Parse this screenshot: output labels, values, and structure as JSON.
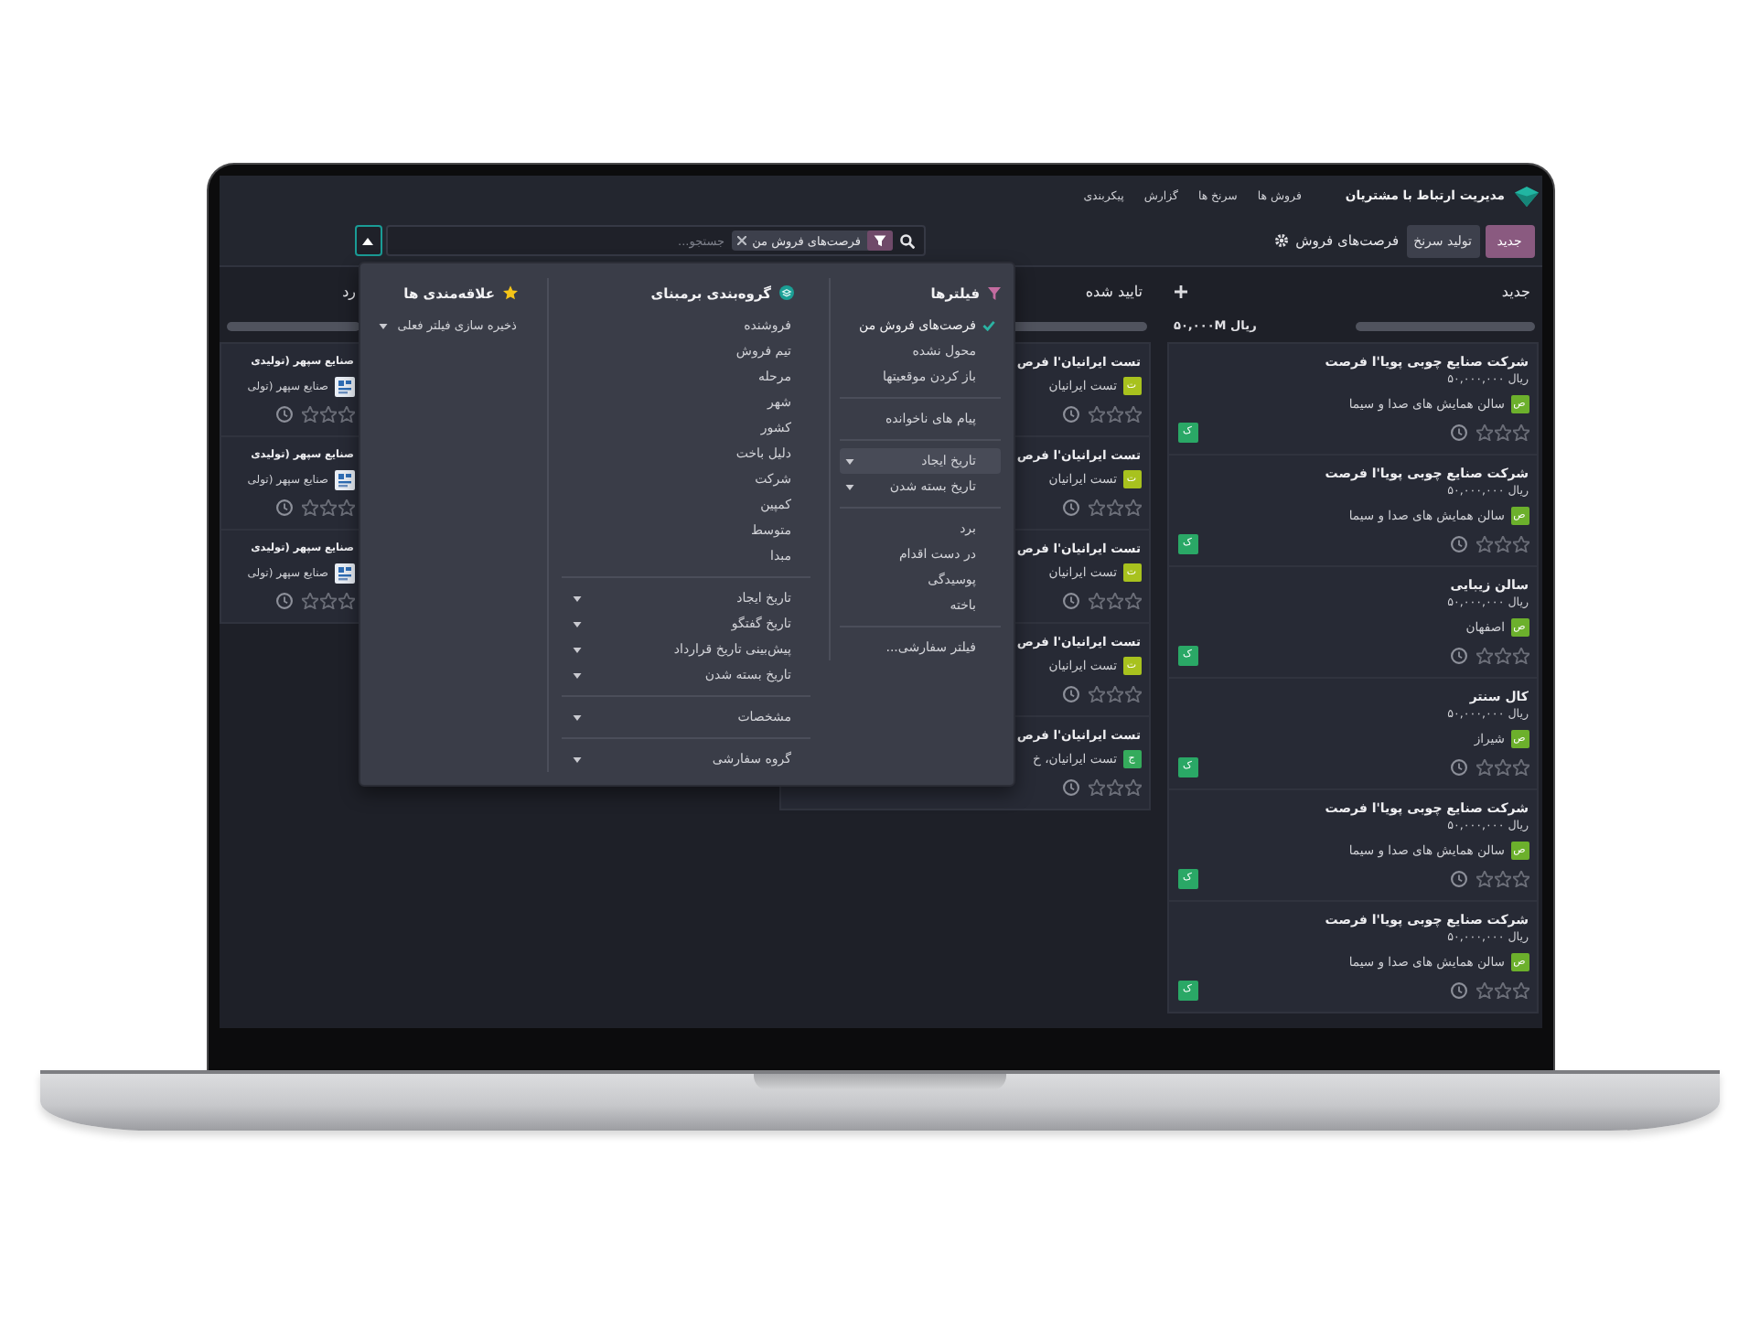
{
  "navbar": {
    "app_title": "مدیریت ارتباط با مشتریان",
    "menu": [
      "فروش ها",
      "سرنخ ها",
      "گزارش",
      "پیکربندی"
    ]
  },
  "control_panel": {
    "buttons": [
      {
        "label": "جدید",
        "kind": "primary"
      },
      {
        "label": "تولید سرنخ",
        "kind": "secondary"
      }
    ],
    "breadcrumb": "فرصت‌های فروش",
    "search": {
      "facet": "فرصت‌های فروش من",
      "placeholder": "جستجو..."
    }
  },
  "kanban": {
    "columns": [
      {
        "title": "جدید",
        "quick_create": true,
        "level": 1,
        "total": "ریال ۵۰,۰۰۰M",
        "cards": [
          {
            "title": "شرکت صنایع چوبی پویا'ا فرصت",
            "amount": "ریال ۵۰,۰۰۰,۰۰۰",
            "customer": "سالن همایش های صدا و سیما",
            "avatar": {
              "kind": "letter",
              "letter": "ص",
              "color": "#6cb02c"
            },
            "stars": 0,
            "assignee": "ک"
          },
          {
            "title": "شرکت صنایع چوبی پویا'ا فرصت",
            "amount": "ریال ۵۰,۰۰۰,۰۰۰",
            "customer": "سالن همایش های صدا و سیما",
            "avatar": {
              "kind": "letter",
              "letter": "ص",
              "color": "#6cb02c"
            },
            "stars": 0,
            "assignee": "ک"
          },
          {
            "title": "سالن زیبایی",
            "amount": "ریال ۵۰,۰۰۰,۰۰۰",
            "customer": "اصفهان",
            "avatar": {
              "kind": "letter",
              "letter": "ص",
              "color": "#6cb02c"
            },
            "stars": 0,
            "assignee": "ک"
          },
          {
            "title": "کال سنتر",
            "amount": "ریال ۵۰,۰۰۰,۰۰۰",
            "customer": "شیراز",
            "avatar": {
              "kind": "letter",
              "letter": "ص",
              "color": "#6cb02c"
            },
            "stars": 0,
            "assignee": "ک"
          },
          {
            "title": "شرکت صنایع چوبی پویا'ا فرصت",
            "amount": "ریال ۵۰,۰۰۰,۰۰۰",
            "customer": "سالن همایش های صدا و سیما",
            "avatar": {
              "kind": "letter",
              "letter": "ص",
              "color": "#6cb02c"
            },
            "stars": 0,
            "assignee": "ک"
          },
          {
            "title": "شرکت صنایع چوبی پویا'ا فرصت",
            "amount": "ریال ۵۰,۰۰۰,۰۰۰",
            "customer": "سالن همایش های صدا و سیما",
            "avatar": {
              "kind": "letter",
              "letter": "ص",
              "color": "#6cb02c"
            },
            "stars": 0,
            "assignee": "ک"
          }
        ]
      },
      {
        "title": "تایید شده",
        "level": 1,
        "cards": [
          {
            "title": "تست ایرانیان'ا فرص",
            "customer": "تست ایرانیان",
            "avatar": {
              "kind": "letter",
              "letter": "ت",
              "color": "#a8c21e"
            },
            "stars": 0
          },
          {
            "title": "تست ایرانیان'ا فرص",
            "customer": "تست ایرانیان",
            "avatar": {
              "kind": "letter",
              "letter": "ت",
              "color": "#a8c21e"
            },
            "stars": 0
          },
          {
            "title": "تست ایرانیان'ا فرص",
            "customer": "تست ایرانیان",
            "avatar": {
              "kind": "letter",
              "letter": "ت",
              "color": "#a8c21e"
            },
            "stars": 0
          },
          {
            "title": "تست ایرانیان'ا فرص",
            "customer": "تست ایرانیان",
            "avatar": {
              "kind": "letter",
              "letter": "ت",
              "color": "#a8c21e"
            },
            "stars": 0
          },
          {
            "title": "تست ایرانیان'ا فرص",
            "customer": "تست ایرانیان، خ",
            "avatar": {
              "kind": "letter",
              "letter": "ج",
              "color": "#35ab5c"
            },
            "stars": 0
          }
        ]
      },
      {
        "title": "رد",
        "quick_create": false,
        "level": 1,
        "cards": [
          {
            "title": "صنایع سپهر (تولیدی",
            "customer": "صنایع سپهر (تولی",
            "avatar": {
              "kind": "logo"
            },
            "stars": 0
          },
          {
            "title": "صنایع سپهر (تولیدی",
            "customer": "صنایع سپهر (تولی",
            "avatar": {
              "kind": "logo"
            },
            "stars": 0
          },
          {
            "title": "صنایع سپهر (تولیدی",
            "customer": "صنایع سپهر (تولی",
            "avatar": {
              "kind": "logo"
            },
            "stars": 0
          }
        ]
      }
    ]
  },
  "search_panel": {
    "filters": {
      "title": "فیلترها",
      "groups": [
        {
          "items": [
            {
              "label": "فرصت‌های فروش من",
              "kind": "option",
              "checked": true
            },
            {
              "label": "محول نشده",
              "kind": "option",
              "checked": false
            },
            {
              "label": "باز کردن موقعیتها",
              "kind": "option",
              "checked": false
            }
          ]
        },
        {
          "items": [
            {
              "label": "پیام های ناخوانده",
              "kind": "option",
              "checked": false
            }
          ]
        },
        {
          "items": [
            {
              "label": "تاریخ ایجاد",
              "kind": "submenu",
              "highlighted": true
            },
            {
              "label": "تاریخ بسته شدن",
              "kind": "submenu",
              "highlighted": false
            }
          ]
        },
        {
          "items": [
            {
              "label": "برد",
              "kind": "option",
              "checked": false
            },
            {
              "label": "در دست اقدام",
              "kind": "option",
              "checked": false
            },
            {
              "label": "پوسیدگی",
              "kind": "option",
              "checked": false
            },
            {
              "label": "باخته",
              "kind": "option",
              "checked": false
            }
          ]
        },
        {
          "items": [
            {
              "label": "فیلتر سفارشی...",
              "kind": "action"
            }
          ]
        }
      ]
    },
    "group_by": {
      "title": "گروه‌بندی برمبنای",
      "groups": [
        {
          "items": [
            {
              "label": "فروشنده",
              "kind": "option"
            },
            {
              "label": "تیم فروش",
              "kind": "option"
            },
            {
              "label": "مرحله",
              "kind": "option"
            },
            {
              "label": "شهر",
              "kind": "option"
            },
            {
              "label": "کشور",
              "kind": "option"
            },
            {
              "label": "دلیل باخت",
              "kind": "option"
            },
            {
              "label": "شرکت",
              "kind": "option"
            },
            {
              "label": "کمپین",
              "kind": "option"
            },
            {
              "label": "متوسط",
              "kind": "option"
            },
            {
              "label": "مبدا",
              "kind": "option"
            }
          ]
        },
        {
          "items": [
            {
              "label": "تاریخ ایجاد",
              "kind": "submenu"
            },
            {
              "label": "تاریخ گفتگو",
              "kind": "submenu"
            },
            {
              "label": "پیش‌بینی تاریخ قرارداد",
              "kind": "submenu"
            },
            {
              "label": "تاریخ بسته شدن",
              "kind": "submenu"
            }
          ]
        },
        {
          "items": [
            {
              "label": "مشخصات",
              "kind": "submenu"
            }
          ]
        },
        {
          "items": [
            {
              "label": "گروه سفارشی",
              "kind": "select"
            }
          ]
        }
      ]
    },
    "favorites": {
      "title": "علاقه‌مندی ها",
      "groups": [
        {
          "items": [
            {
              "label": "ذخیره سازی فیلتر فعلی",
              "kind": "submenu"
            }
          ]
        }
      ]
    }
  }
}
